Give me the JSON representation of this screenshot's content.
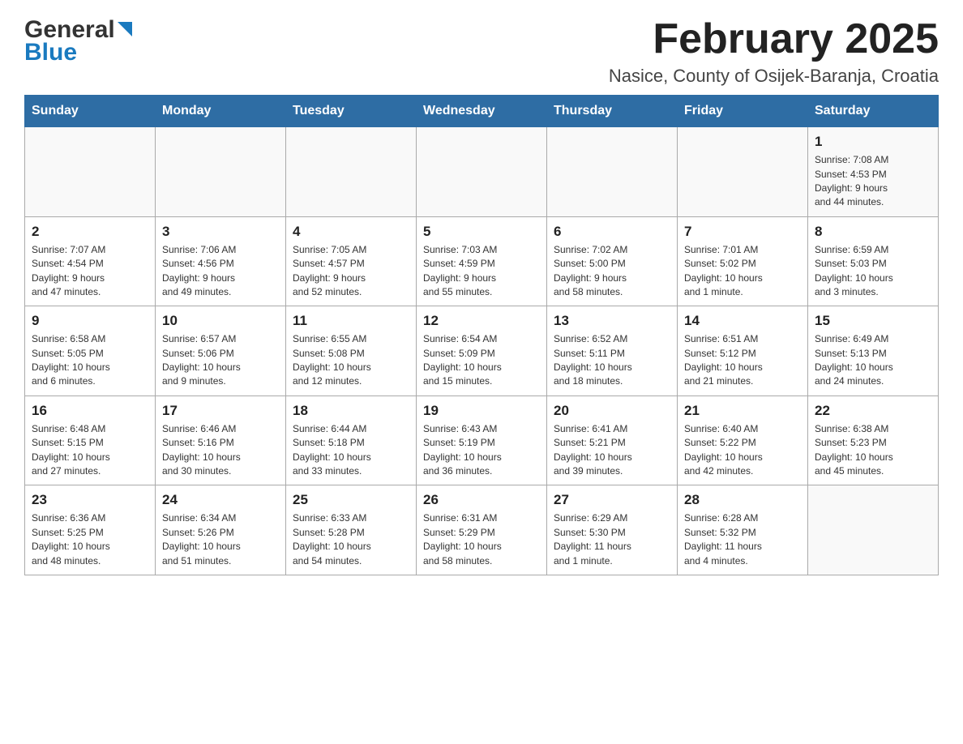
{
  "header": {
    "logo_general": "General",
    "logo_blue": "Blue",
    "month": "February 2025",
    "location": "Nasice, County of Osijek-Baranja, Croatia"
  },
  "days_of_week": [
    "Sunday",
    "Monday",
    "Tuesday",
    "Wednesday",
    "Thursday",
    "Friday",
    "Saturday"
  ],
  "weeks": [
    [
      {
        "day": "",
        "info": ""
      },
      {
        "day": "",
        "info": ""
      },
      {
        "day": "",
        "info": ""
      },
      {
        "day": "",
        "info": ""
      },
      {
        "day": "",
        "info": ""
      },
      {
        "day": "",
        "info": ""
      },
      {
        "day": "1",
        "info": "Sunrise: 7:08 AM\nSunset: 4:53 PM\nDaylight: 9 hours\nand 44 minutes."
      }
    ],
    [
      {
        "day": "2",
        "info": "Sunrise: 7:07 AM\nSunset: 4:54 PM\nDaylight: 9 hours\nand 47 minutes."
      },
      {
        "day": "3",
        "info": "Sunrise: 7:06 AM\nSunset: 4:56 PM\nDaylight: 9 hours\nand 49 minutes."
      },
      {
        "day": "4",
        "info": "Sunrise: 7:05 AM\nSunset: 4:57 PM\nDaylight: 9 hours\nand 52 minutes."
      },
      {
        "day": "5",
        "info": "Sunrise: 7:03 AM\nSunset: 4:59 PM\nDaylight: 9 hours\nand 55 minutes."
      },
      {
        "day": "6",
        "info": "Sunrise: 7:02 AM\nSunset: 5:00 PM\nDaylight: 9 hours\nand 58 minutes."
      },
      {
        "day": "7",
        "info": "Sunrise: 7:01 AM\nSunset: 5:02 PM\nDaylight: 10 hours\nand 1 minute."
      },
      {
        "day": "8",
        "info": "Sunrise: 6:59 AM\nSunset: 5:03 PM\nDaylight: 10 hours\nand 3 minutes."
      }
    ],
    [
      {
        "day": "9",
        "info": "Sunrise: 6:58 AM\nSunset: 5:05 PM\nDaylight: 10 hours\nand 6 minutes."
      },
      {
        "day": "10",
        "info": "Sunrise: 6:57 AM\nSunset: 5:06 PM\nDaylight: 10 hours\nand 9 minutes."
      },
      {
        "day": "11",
        "info": "Sunrise: 6:55 AM\nSunset: 5:08 PM\nDaylight: 10 hours\nand 12 minutes."
      },
      {
        "day": "12",
        "info": "Sunrise: 6:54 AM\nSunset: 5:09 PM\nDaylight: 10 hours\nand 15 minutes."
      },
      {
        "day": "13",
        "info": "Sunrise: 6:52 AM\nSunset: 5:11 PM\nDaylight: 10 hours\nand 18 minutes."
      },
      {
        "day": "14",
        "info": "Sunrise: 6:51 AM\nSunset: 5:12 PM\nDaylight: 10 hours\nand 21 minutes."
      },
      {
        "day": "15",
        "info": "Sunrise: 6:49 AM\nSunset: 5:13 PM\nDaylight: 10 hours\nand 24 minutes."
      }
    ],
    [
      {
        "day": "16",
        "info": "Sunrise: 6:48 AM\nSunset: 5:15 PM\nDaylight: 10 hours\nand 27 minutes."
      },
      {
        "day": "17",
        "info": "Sunrise: 6:46 AM\nSunset: 5:16 PM\nDaylight: 10 hours\nand 30 minutes."
      },
      {
        "day": "18",
        "info": "Sunrise: 6:44 AM\nSunset: 5:18 PM\nDaylight: 10 hours\nand 33 minutes."
      },
      {
        "day": "19",
        "info": "Sunrise: 6:43 AM\nSunset: 5:19 PM\nDaylight: 10 hours\nand 36 minutes."
      },
      {
        "day": "20",
        "info": "Sunrise: 6:41 AM\nSunset: 5:21 PM\nDaylight: 10 hours\nand 39 minutes."
      },
      {
        "day": "21",
        "info": "Sunrise: 6:40 AM\nSunset: 5:22 PM\nDaylight: 10 hours\nand 42 minutes."
      },
      {
        "day": "22",
        "info": "Sunrise: 6:38 AM\nSunset: 5:23 PM\nDaylight: 10 hours\nand 45 minutes."
      }
    ],
    [
      {
        "day": "23",
        "info": "Sunrise: 6:36 AM\nSunset: 5:25 PM\nDaylight: 10 hours\nand 48 minutes."
      },
      {
        "day": "24",
        "info": "Sunrise: 6:34 AM\nSunset: 5:26 PM\nDaylight: 10 hours\nand 51 minutes."
      },
      {
        "day": "25",
        "info": "Sunrise: 6:33 AM\nSunset: 5:28 PM\nDaylight: 10 hours\nand 54 minutes."
      },
      {
        "day": "26",
        "info": "Sunrise: 6:31 AM\nSunset: 5:29 PM\nDaylight: 10 hours\nand 58 minutes."
      },
      {
        "day": "27",
        "info": "Sunrise: 6:29 AM\nSunset: 5:30 PM\nDaylight: 11 hours\nand 1 minute."
      },
      {
        "day": "28",
        "info": "Sunrise: 6:28 AM\nSunset: 5:32 PM\nDaylight: 11 hours\nand 4 minutes."
      },
      {
        "day": "",
        "info": ""
      }
    ]
  ]
}
